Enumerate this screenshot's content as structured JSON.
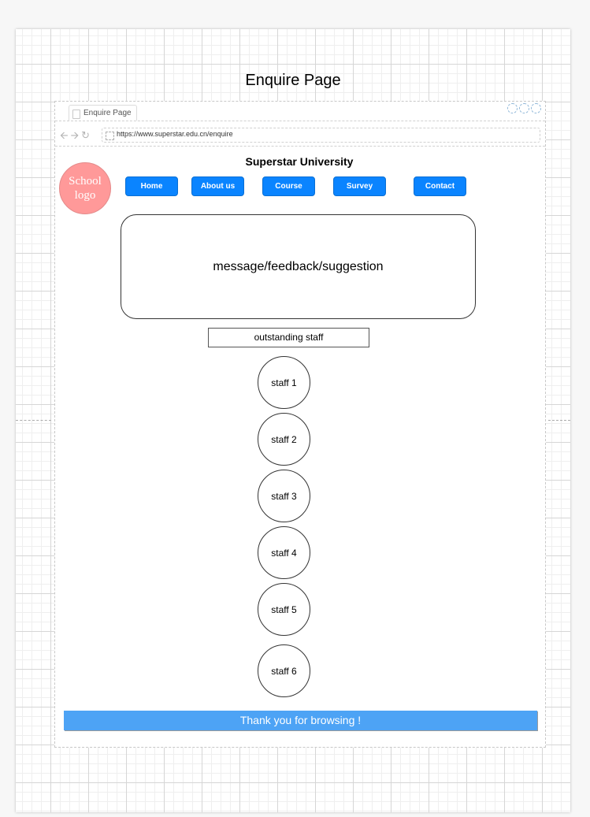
{
  "document": {
    "title": "Enquire Page"
  },
  "browser": {
    "tab_label": "Enquire Page",
    "url": "https://www.superstar.edu.cn/enquire",
    "nav_icons": [
      "back-arrow-icon",
      "forward-arrow-icon",
      "reload-icon"
    ]
  },
  "header": {
    "site_name": "Superstar University",
    "logo_text": "School logo"
  },
  "nav": {
    "items": [
      {
        "label": "Home"
      },
      {
        "label": "About us"
      },
      {
        "label": "Course"
      },
      {
        "label": "Survey"
      },
      {
        "label": "Contact"
      }
    ]
  },
  "main": {
    "message_box": "message/feedback/suggestion",
    "staff_heading": "outstanding staff",
    "staff": [
      {
        "label": "staff 1"
      },
      {
        "label": "staff 2"
      },
      {
        "label": "staff 3"
      },
      {
        "label": "staff 4"
      },
      {
        "label": "staff 5"
      },
      {
        "label": "staff 6"
      }
    ]
  },
  "footer": {
    "text": "Thank you for browsing !"
  },
  "colors": {
    "nav_button": "#0a84ff",
    "logo": "#ff9999",
    "footer": "#4da3f5"
  }
}
